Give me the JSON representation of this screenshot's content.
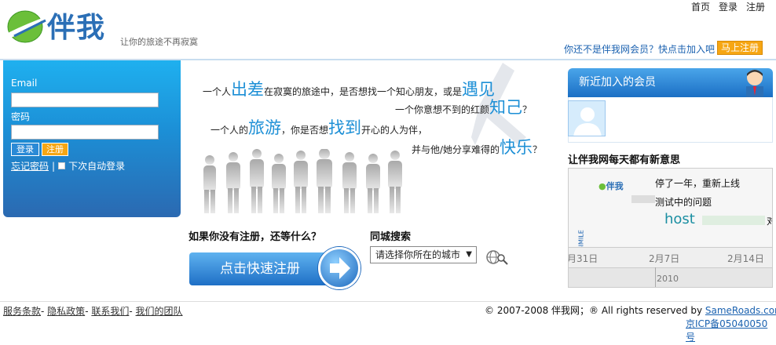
{
  "header": {
    "logo_text": "伴我",
    "slogan": "让你的旅途不再寂寞",
    "nav": [
      "首页",
      "登录",
      "注册"
    ],
    "join_prompt": "你还不是伴我网会员？快点击加入吧",
    "join_button": "马上注册"
  },
  "login": {
    "email_label": "Email",
    "password_label": "密码",
    "login_button": "登录",
    "register_button": "注册",
    "forgot_link": "忘记密码",
    "separator": "|",
    "remember_label": "下次自动登录"
  },
  "slogan_lines": {
    "l1_pre": "一个人",
    "l1_big": "出差",
    "l1_mid": "在寂寞的旅途中，是否想找一个知心朋友，或是",
    "l1_big2": "遇见",
    "l2_pre": "一个你意想不到的红颜",
    "l2_big": "知己",
    "l2_end": "？",
    "l3_pre": "一个人的",
    "l3_big": "旅游",
    "l3_mid": "，你是否想",
    "l3_big2": "找到",
    "l3_end": "开心的人为伴，",
    "l4_pre": "并与他/她分享难得的",
    "l4_big": "快乐",
    "l4_end": "？"
  },
  "register": {
    "title": "如果你没有注册，还等什么？",
    "button": "点击快速注册"
  },
  "city": {
    "title": "同城搜索",
    "selected": "请选择你所在的城市"
  },
  "members": {
    "title": "新近加入的会员"
  },
  "news": {
    "title": "让伴我网每天都有新意思",
    "timeline_logo": "伴我",
    "event1": "停了一年，重新上线",
    "event2": "测试中的问题",
    "event3": "host",
    "event3_tail": "对",
    "vertical_label": "Timeline © SIMILE",
    "dates": [
      "月31日",
      "2月7日",
      "2月14日"
    ],
    "year": "2010"
  },
  "footer": {
    "links": [
      "服务条款",
      "隐私政策",
      "联系我们",
      "我们的团队"
    ],
    "copyright_pre": "© 2007-2008 伴我网；® All rights reserved by ",
    "copyright_site": "SameRoads.com",
    "icp": "京ICP备05040050号"
  },
  "colors": {
    "brand_blue": "#1c8fd6",
    "accent_orange": "#f6a613",
    "link_blue": "#1b62b0"
  }
}
